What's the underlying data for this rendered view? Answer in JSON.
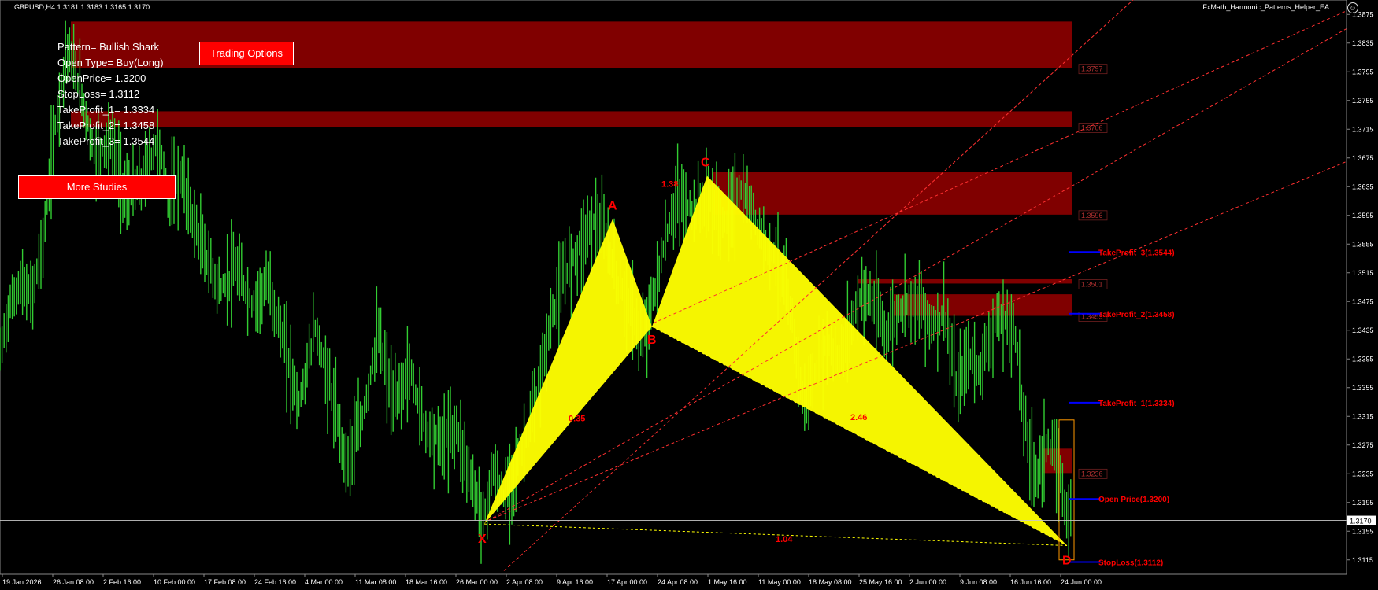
{
  "header": {
    "symbol_info": "GBPUSD,H4  1.3181 1.3183 1.3165 1.3170",
    "ea_name": "FxMath_Harmonic_Patterns_Helper_EA"
  },
  "pattern_info": {
    "lines": [
      "Pattern= Bullish Shark",
      "Open Type= Buy(Long)",
      "OpenPrice= 1.3200",
      "StopLoss= 1.3112",
      "TakeProfit_1= 1.3334",
      "TakeProfit_2= 1.3458",
      "TakeProfit_3= 1.3544"
    ]
  },
  "buttons": {
    "trading_options": "Trading Options",
    "more_studies": "More Studies"
  },
  "colors": {
    "candle": "#32cd32",
    "pattern_fill": "#ffff00",
    "zone": "#800000",
    "accent_red": "#ff0000",
    "level_line": "#0000ff",
    "background": "#000000"
  },
  "chart_data": {
    "type": "candlestick",
    "symbol": "GBPUSD",
    "timeframe": "H4",
    "ylim": [
      1.3095,
      1.3895
    ],
    "current_price": "1.3170",
    "y_ticks": [
      "1.3875",
      "1.3835",
      "1.3795",
      "1.3755",
      "1.3715",
      "1.3675",
      "1.3635",
      "1.3595",
      "1.3555",
      "1.3515",
      "1.3475",
      "1.3435",
      "1.3395",
      "1.3355",
      "1.3315",
      "1.3275",
      "1.3235",
      "1.3195",
      "1.3155",
      "1.3115"
    ],
    "x_ticks": [
      "19 Jan 2026",
      "26 Jan 08:00",
      "2 Feb 16:00",
      "10 Feb 00:00",
      "17 Feb 08:00",
      "24 Feb 16:00",
      "4 Mar 00:00",
      "11 Mar 08:00",
      "18 Mar 16:00",
      "26 Mar 00:00",
      "2 Apr 08:00",
      "9 Apr 16:00",
      "17 Apr 00:00",
      "24 Apr 08:00",
      "1 May 16:00",
      "11 May 00:00",
      "18 May 08:00",
      "25 May 16:00",
      "2 Jun 00:00",
      "9 Jun 08:00",
      "16 Jun 16:00",
      "24 Jun 00:00"
    ],
    "price_path": [
      [
        0,
        1.34
      ],
      [
        10,
        1.346
      ],
      [
        25,
        1.35
      ],
      [
        40,
        1.348
      ],
      [
        55,
        1.356
      ],
      [
        70,
        1.372
      ],
      [
        85,
        1.383
      ],
      [
        100,
        1.378
      ],
      [
        120,
        1.368
      ],
      [
        140,
        1.37
      ],
      [
        160,
        1.362
      ],
      [
        180,
        1.364
      ],
      [
        200,
        1.37
      ],
      [
        215,
        1.362
      ],
      [
        230,
        1.365
      ],
      [
        245,
        1.359
      ],
      [
        260,
        1.354
      ],
      [
        280,
        1.349
      ],
      [
        300,
        1.352
      ],
      [
        320,
        1.347
      ],
      [
        340,
        1.35
      ],
      [
        360,
        1.342
      ],
      [
        380,
        1.333
      ],
      [
        400,
        1.344
      ],
      [
        420,
        1.335
      ],
      [
        440,
        1.325
      ],
      [
        460,
        1.331
      ],
      [
        480,
        1.343
      ],
      [
        500,
        1.333
      ],
      [
        520,
        1.338
      ],
      [
        540,
        1.33
      ],
      [
        560,
        1.328
      ],
      [
        580,
        1.33
      ],
      [
        600,
        1.322
      ],
      [
        615,
        1.317
      ],
      [
        625,
        1.324
      ],
      [
        640,
        1.32
      ],
      [
        660,
        1.326
      ],
      [
        680,
        1.333
      ],
      [
        700,
        1.345
      ],
      [
        720,
        1.352
      ],
      [
        740,
        1.356
      ],
      [
        755,
        1.359
      ],
      [
        770,
        1.356
      ],
      [
        785,
        1.35
      ],
      [
        800,
        1.347
      ],
      [
        815,
        1.342
      ],
      [
        830,
        1.348
      ],
      [
        845,
        1.356
      ],
      [
        860,
        1.362
      ],
      [
        880,
        1.36
      ],
      [
        900,
        1.362
      ],
      [
        920,
        1.358
      ],
      [
        940,
        1.363
      ],
      [
        955,
        1.36
      ],
      [
        970,
        1.356
      ],
      [
        985,
        1.354
      ],
      [
        1000,
        1.348
      ],
      [
        1010,
        1.342
      ],
      [
        1020,
        1.333
      ],
      [
        1035,
        1.337
      ],
      [
        1050,
        1.342
      ],
      [
        1065,
        1.339
      ],
      [
        1080,
        1.344
      ],
      [
        1095,
        1.349
      ],
      [
        1110,
        1.347
      ],
      [
        1125,
        1.343
      ],
      [
        1140,
        1.346
      ],
      [
        1155,
        1.348
      ],
      [
        1170,
        1.347
      ],
      [
        1185,
        1.344
      ],
      [
        1200,
        1.346
      ],
      [
        1215,
        1.335
      ],
      [
        1230,
        1.34
      ],
      [
        1245,
        1.338
      ],
      [
        1260,
        1.344
      ],
      [
        1275,
        1.345
      ],
      [
        1290,
        1.343
      ],
      [
        1300,
        1.331
      ],
      [
        1315,
        1.323
      ],
      [
        1330,
        1.328
      ],
      [
        1345,
        1.324
      ],
      [
        1355,
        1.318
      ],
      [
        1365,
        1.316
      ]
    ],
    "points": [
      {
        "label": "X",
        "price": 1.3165,
        "x_index": 615
      },
      {
        "label": "A",
        "price": 1.359,
        "x_index": 778
      },
      {
        "label": "B",
        "price": 1.344,
        "x_index": 828
      },
      {
        "label": "C",
        "price": 1.365,
        "x_index": 898
      },
      {
        "label": "D",
        "price": 1.3135,
        "x_index": 1355
      }
    ],
    "ratios": [
      {
        "text": "0.35",
        "price": 1.3308,
        "x_index": 722
      },
      {
        "text": "1.38",
        "price": 1.3635,
        "x_index": 840
      },
      {
        "text": "2.46",
        "price": 1.331,
        "x_index": 1080
      },
      {
        "text": "1.04",
        "price": 1.314,
        "x_index": 985
      }
    ],
    "zones": [
      {
        "label": "1.3797",
        "top": 1.3865,
        "bottom": 1.38
      },
      {
        "label": "1.3706",
        "top": 1.374,
        "bottom": 1.3718
      },
      {
        "label": "1.3596",
        "top": 1.3655,
        "bottom": 1.3596
      },
      {
        "label": "1.3501",
        "top": 1.3506,
        "bottom": 1.35
      },
      {
        "label": "1.3459",
        "top": 1.3485,
        "bottom": 1.3455
      },
      {
        "label": "1.3236",
        "top": 1.327,
        "bottom": 1.3236
      }
    ],
    "levels": [
      {
        "label": "TakeProfit_3(1.3544)",
        "price": 1.3544
      },
      {
        "label": "TakeProfit_2(1.3458)",
        "price": 1.3458
      },
      {
        "label": "TakeProfit_1(1.3334)",
        "price": 1.3334
      },
      {
        "label": "Open Price(1.3200)",
        "price": 1.32
      },
      {
        "label": "StopLoss(1.3112)",
        "price": 1.3112
      }
    ]
  }
}
